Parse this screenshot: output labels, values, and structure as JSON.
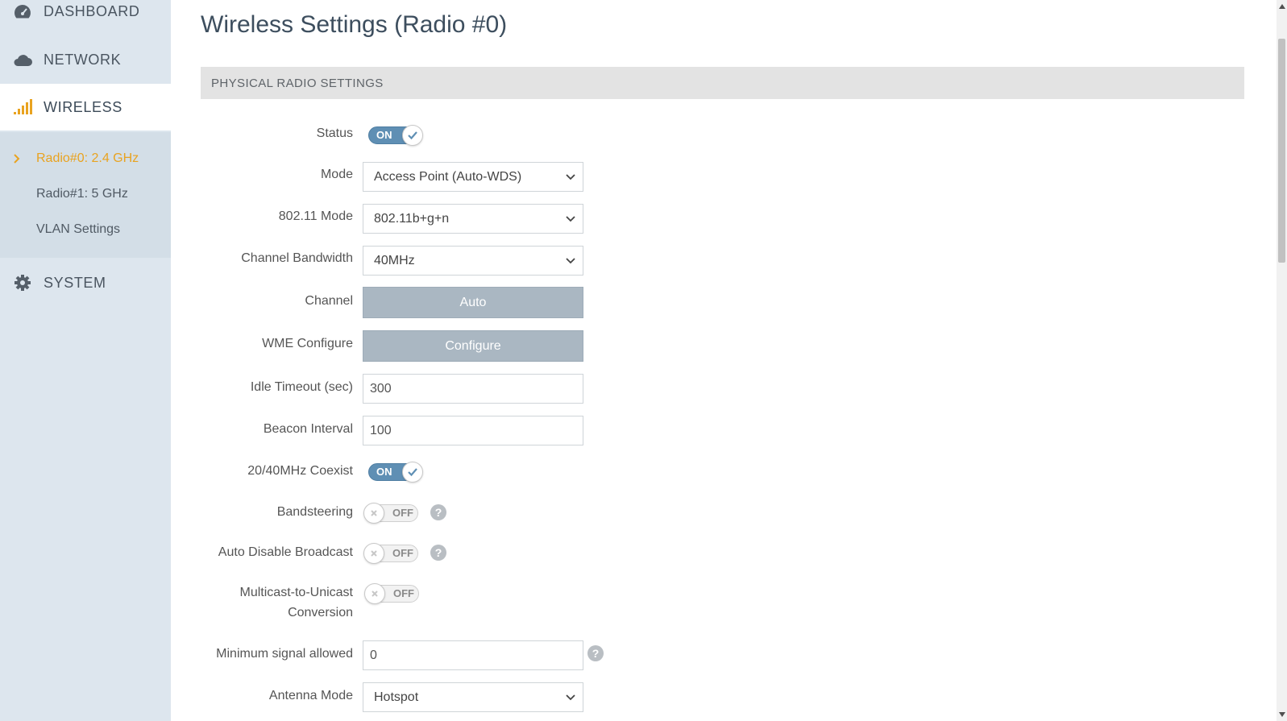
{
  "sidebar": {
    "nav": {
      "dashboard": "DASHBOARD",
      "network": "NETWORK",
      "wireless": "WIRELESS",
      "system": "SYSTEM"
    },
    "sub": {
      "radio0": "Radio#0: 2.4 GHz",
      "radio1": "Radio#1: 5 GHz",
      "vlan": "VLAN Settings"
    }
  },
  "page": {
    "title": "Wireless Settings (Radio #0)",
    "section": "PHYSICAL RADIO SETTINGS"
  },
  "form": {
    "status": {
      "label": "Status",
      "state": "ON"
    },
    "mode": {
      "label": "Mode",
      "value": "Access Point (Auto-WDS)"
    },
    "dot11": {
      "label": "802.11 Mode",
      "value": "802.11b+g+n"
    },
    "bandwidth": {
      "label": "Channel Bandwidth",
      "value": "40MHz"
    },
    "channel": {
      "label": "Channel",
      "button": "Auto"
    },
    "wme": {
      "label": "WME Configure",
      "button": "Configure"
    },
    "idle": {
      "label": "Idle Timeout (sec)",
      "value": "300"
    },
    "beacon": {
      "label": "Beacon Interval",
      "value": "100"
    },
    "coexist": {
      "label": "20/40MHz Coexist",
      "state": "ON"
    },
    "bandsteering": {
      "label": "Bandsteering",
      "state": "OFF"
    },
    "autodisable": {
      "label": "Auto Disable Broadcast",
      "state": "OFF"
    },
    "multicast": {
      "label_line1": "Multicast-to-Unicast",
      "label_line2": "Conversion",
      "state": "OFF"
    },
    "minsignal": {
      "label": "Minimum signal allowed",
      "value": "0"
    },
    "antenna": {
      "label": "Antenna Mode",
      "value": "Hotspot"
    }
  },
  "help_glyph": "?",
  "colors": {
    "accent": "#e9a320",
    "toggle_on": "#5f8fb4",
    "button": "#aab7c2"
  }
}
